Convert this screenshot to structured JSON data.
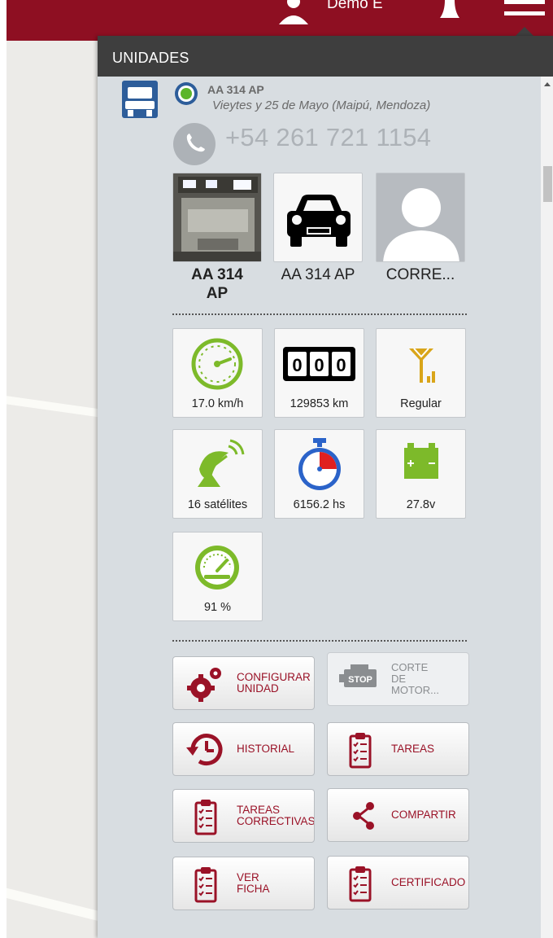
{
  "topbar": {
    "user_name": "Demo E"
  },
  "panel": {
    "title": "UNIDADES"
  },
  "unit": {
    "name": "AA 314 AP",
    "address": "Vieytes y 25 de Mayo (Maipú, Mendoza)",
    "phone": "+54 261 721 1154"
  },
  "photos": [
    {
      "label": "AA 314\nAP",
      "icon": "truck-photo"
    },
    {
      "label": "AA 314 AP",
      "icon": "car-icon"
    },
    {
      "label": "CORRE...",
      "icon": "person-avatar-icon"
    }
  ],
  "metrics": [
    {
      "value": "17.0 km/h",
      "icon": "speedometer-icon"
    },
    {
      "value": "129853 km",
      "icon": "odometer-icon",
      "digits": "000"
    },
    {
      "value": "Regular",
      "icon": "signal-icon"
    },
    {
      "value": "16 satélites",
      "icon": "satellite-icon"
    },
    {
      "value": "6156.2 hs",
      "icon": "stopwatch-icon"
    },
    {
      "value": "27.8v",
      "icon": "battery-icon"
    },
    {
      "value": "91 %",
      "icon": "gauge-icon"
    }
  ],
  "actions": [
    {
      "label": "CONFIGURAR\nUNIDAD",
      "icon": "gears-icon",
      "enabled": true
    },
    {
      "label": "CORTE\nDE\nMOTOR...",
      "icon": "engine-stop-icon",
      "enabled": false
    },
    {
      "label": "HISTORIAL",
      "icon": "history-icon",
      "enabled": true
    },
    {
      "label": "TAREAS",
      "icon": "clipboard-icon",
      "enabled": true
    },
    {
      "label": "TAREAS\nCORRECTIVAS",
      "icon": "clipboard-icon",
      "enabled": true
    },
    {
      "label": "COMPARTIR",
      "icon": "share-icon",
      "enabled": true
    },
    {
      "label": "VER\nFICHA",
      "icon": "clipboard-icon",
      "enabled": true
    },
    {
      "label": "CERTIFICADO",
      "icon": "clipboard-icon",
      "enabled": true
    }
  ],
  "colors": {
    "brand": "#8e0f22",
    "panel_header": "#3e3e3e",
    "panel_body": "#d8dde1",
    "green": "#7dba2a",
    "action_text": "#9a1227"
  }
}
